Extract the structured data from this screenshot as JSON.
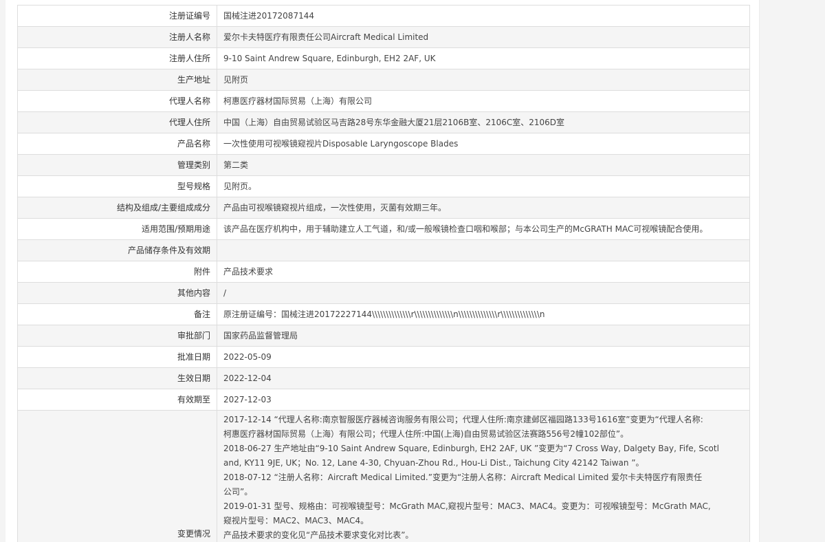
{
  "rows": [
    {
      "label": "注册证编号",
      "value": "国械注进20172087144"
    },
    {
      "label": "注册人名称",
      "value": "爱尔卡夫特医疗有限责任公司Aircraft Medical Limited"
    },
    {
      "label": "注册人住所",
      "value": "9-10 Saint Andrew Square, Edinburgh, EH2 2AF, UK"
    },
    {
      "label": "生产地址",
      "value": "见附页"
    },
    {
      "label": "代理人名称",
      "value": "柯惠医疗器材国际贸易（上海）有限公司"
    },
    {
      "label": "代理人住所",
      "value": "中国（上海）自由贸易试验区马吉路28号东华金融大厦21层2106B室、2106C室、2106D室"
    },
    {
      "label": "产品名称",
      "value": "一次性使用可视喉镜窥视片Disposable Laryngoscope Blades"
    },
    {
      "label": "管理类别",
      "value": "第二类"
    },
    {
      "label": "型号规格",
      "value": "见附页。"
    },
    {
      "label": "结构及组成/主要组成成分",
      "value": "产品由可视喉镜窥视片组成，一次性使用，灭菌有效期三年。"
    },
    {
      "label": "适用范围/预期用途",
      "value": "该产品在医疗机构中，用于辅助建立人工气道，和/或一般喉镜检查口咽和喉部；与本公司生产的McGRATH MAC可视喉镜配合使用。"
    },
    {
      "label": "产品储存条件及有效期",
      "value": ""
    },
    {
      "label": "附件",
      "value": "产品技术要求"
    },
    {
      "label": "其他内容",
      "value": "/"
    },
    {
      "label": "备注",
      "value": "原注册证编号：国械注进20172227144\\\\\\\\\\\\\\\\\\\\\\\\\\\\r\\\\\\\\\\\\\\\\\\\\\\\\\\\\n\\\\\\\\\\\\\\\\\\\\\\\\\\\\r\\\\\\\\\\\\\\\\\\\\\\\\\\\\n"
    },
    {
      "label": "审批部门",
      "value": "国家药品监督管理局"
    },
    {
      "label": "批准日期",
      "value": "2022-05-09"
    },
    {
      "label": "生效日期",
      "value": "2022-12-04"
    },
    {
      "label": "有效期至",
      "value": "2027-12-03"
    }
  ],
  "changes": {
    "label": "变更情况",
    "lines": [
      "2017-12-14 “代理人名称:南京智服医疗器械咨询服务有限公司；代理人住所:南京建邺区福园路133号1616室”变更为“代理人名称:",
      "柯惠医疗器材国际贸易（上海）有限公司；代理人住所:中国(上海)自由贸易试验区法赛路556号2幢102部位”。",
      "2018-06-27 生产地址由“9-10 Saint Andrew Square, Edinburgh, EH2 2AF, UK ”变更为“7 Cross Way, Dalgety Bay, Fife, Scotl",
      "and, KY11 9JE, UK；No. 12, Lane 4-30, Chyuan-Zhou Rd., Hou-Li Dist., Taichung City 42142 Taiwan ”。",
      "2018-07-12 “注册人名称：Aircraft Medical Limited.”变更为“注册人名称：Aircraft Medical Limited 爱尔卡夫特医疗有限责任",
      "公司”。",
      "2019-01-31 型号、规格由：可视喉镜型号：McGrath MAC,窥视片型号：MAC3、MAC4。变更为：可视喉镜型号：McGrath MAC,",
      "窥视片型号：MAC2、MAC3、MAC4。",
      "产品技术要求的变化见“产品技术要求变化对比表”。"
    ]
  }
}
